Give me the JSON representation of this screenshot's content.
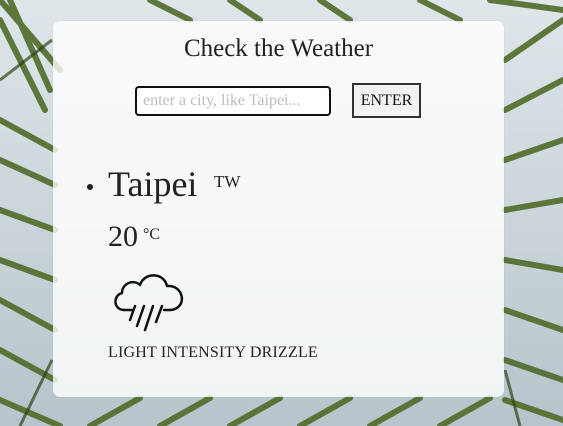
{
  "header": {
    "title": "Check the Weather"
  },
  "search": {
    "placeholder": "enter a city, like Taipei...",
    "value": "",
    "button_label": "ENTER"
  },
  "result": {
    "city": "Taipei",
    "country": "TW",
    "temperature": "20",
    "unit": "°C",
    "icon": "rain-cloud-icon",
    "condition": "LIGHT INTENSITY DRIZZLE"
  },
  "colors": {
    "card": "#ffffff",
    "text": "#222222",
    "palm": "#4f6b2a"
  }
}
